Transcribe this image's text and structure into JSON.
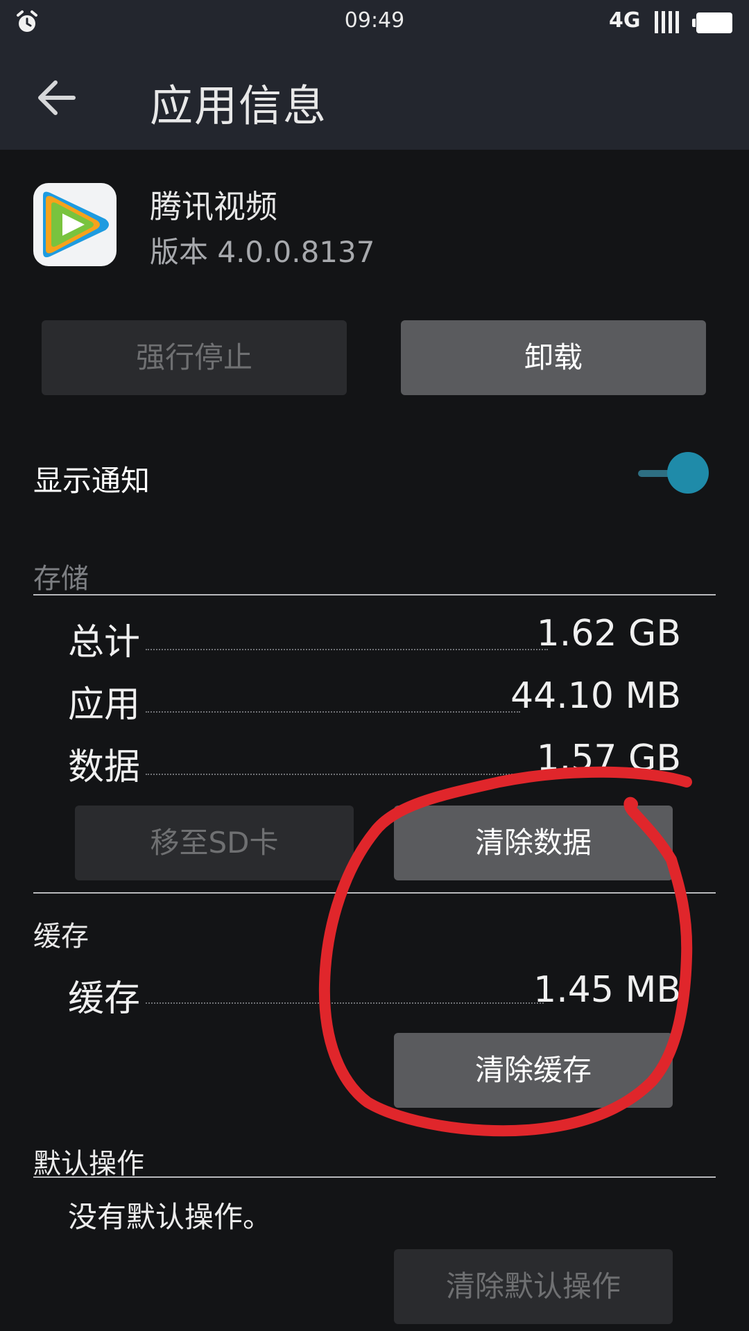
{
  "status_bar": {
    "time": "09:49",
    "network": "4G",
    "battery_color": "#ffffff"
  },
  "header": {
    "title": "应用信息",
    "back_icon": "arrow-left-icon"
  },
  "app": {
    "name": "腾讯视频",
    "version": "版本 4.0.0.8137",
    "icon": "tencent-video-play-icon"
  },
  "actions": {
    "force_stop": "强行停止",
    "uninstall": "卸载"
  },
  "notifications": {
    "label": "显示通知",
    "enabled": true,
    "toggle_color": "#1f8ba9"
  },
  "storage": {
    "section_label": "存储",
    "rows": [
      {
        "label": "总计",
        "value": "1.62 GB"
      },
      {
        "label": "应用",
        "value": "44.10 MB"
      },
      {
        "label": "数据",
        "value": "1.57 GB"
      }
    ],
    "move_to_sd": "移至SD卡",
    "clear_data": "清除数据"
  },
  "cache": {
    "section_label": "缓存",
    "row": {
      "label": "缓存",
      "value": "1.45 MB"
    },
    "clear_cache": "清除缓存"
  },
  "defaults": {
    "section_label": "默认操作",
    "description": "没有默认操作。",
    "clear_defaults": "清除默认操作"
  },
  "annotation": {
    "shape": "hand-drawn-circle",
    "color": "#e0262b"
  }
}
